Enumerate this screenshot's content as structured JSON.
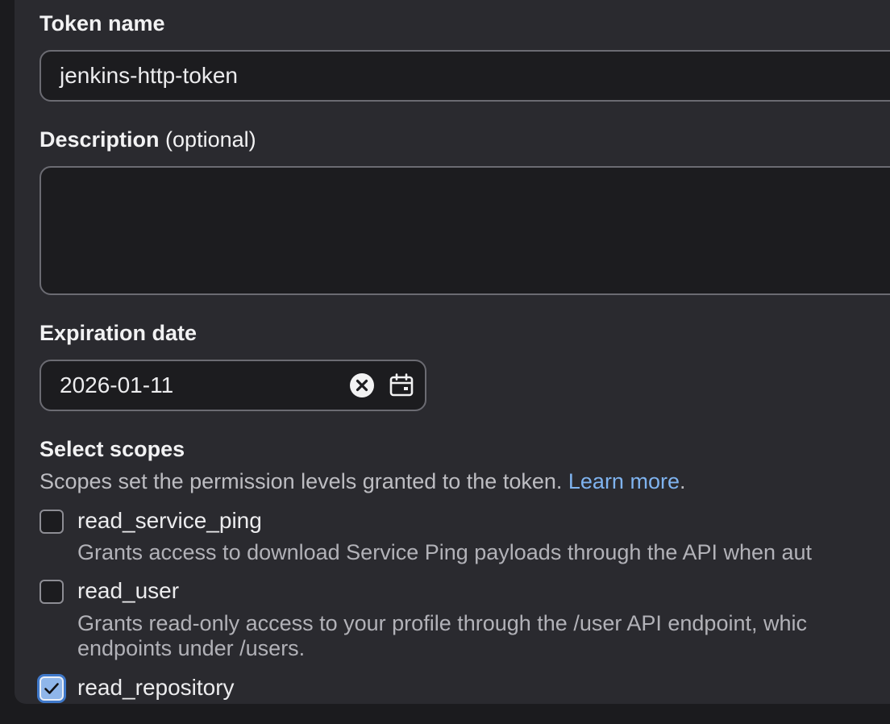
{
  "form": {
    "token_name": {
      "label": "Token name",
      "value": "jenkins-http-token"
    },
    "description": {
      "label": "Description",
      "label_suffix": "(optional)",
      "value": ""
    },
    "expiration": {
      "label": "Expiration date",
      "value": "2026-01-11",
      "clear_icon": "clear-circle-x-icon",
      "calendar_icon": "calendar-icon"
    },
    "scopes": {
      "label": "Select scopes",
      "help_text": "Scopes set the permission levels granted to the token.",
      "learn_more": "Learn more",
      "help_end": ".",
      "items": [
        {
          "name": "read_service_ping",
          "checked": false,
          "desc_line1": "Grants access to download Service Ping payloads through the API when aut"
        },
        {
          "name": "read_user",
          "checked": false,
          "desc_line1": "Grants read-only access to your profile through the /user API endpoint, whic",
          "desc_line2": "endpoints under /users."
        },
        {
          "name": "read_repository",
          "checked": true
        }
      ]
    }
  },
  "colors": {
    "panel": "#2a2a2f",
    "input_bg": "#1c1c1f",
    "link": "#7fb3ef",
    "checkbox_checked": "#8fb6ea"
  }
}
